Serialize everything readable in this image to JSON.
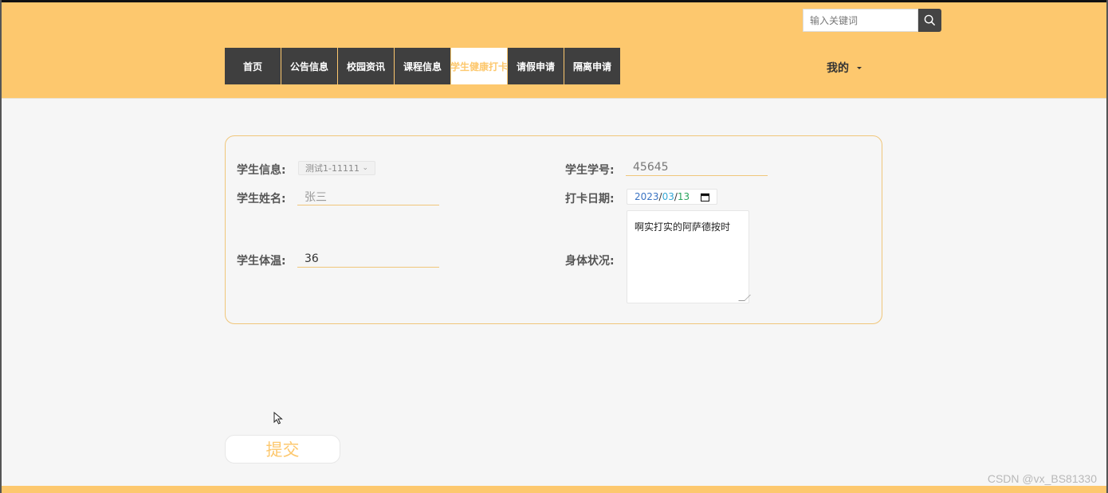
{
  "search": {
    "placeholder": "输入关键词",
    "icon": "search-icon"
  },
  "nav": {
    "items": [
      {
        "label": "首页"
      },
      {
        "label": "公告信息"
      },
      {
        "label": "校园资讯"
      },
      {
        "label": "课程信息"
      },
      {
        "label": "学生健康打卡",
        "active": true
      },
      {
        "label": "请假申请"
      },
      {
        "label": "隔离申请"
      }
    ]
  },
  "user_menu": {
    "label": "我的"
  },
  "form": {
    "student_info": {
      "label": "学生信息:",
      "value": "测试1-11111"
    },
    "student_id": {
      "label": "学生学号:",
      "value": "45645"
    },
    "student_name": {
      "label": "学生姓名:",
      "value": "张三"
    },
    "checkin_date": {
      "label": "打卡日期:",
      "year": "2023",
      "month": "03",
      "day": "13",
      "sep": "/"
    },
    "temperature": {
      "label": "学生体温:",
      "value": "36"
    },
    "condition": {
      "label": "身体状况:",
      "value": "啊实打实的阿萨德按时"
    }
  },
  "submit_label": "提交",
  "watermark": "CSDN @vx_BS81330",
  "colors": {
    "accent": "#fdc86e",
    "nav_bg": "#3f3f3f",
    "background": "#f6f6f6"
  }
}
